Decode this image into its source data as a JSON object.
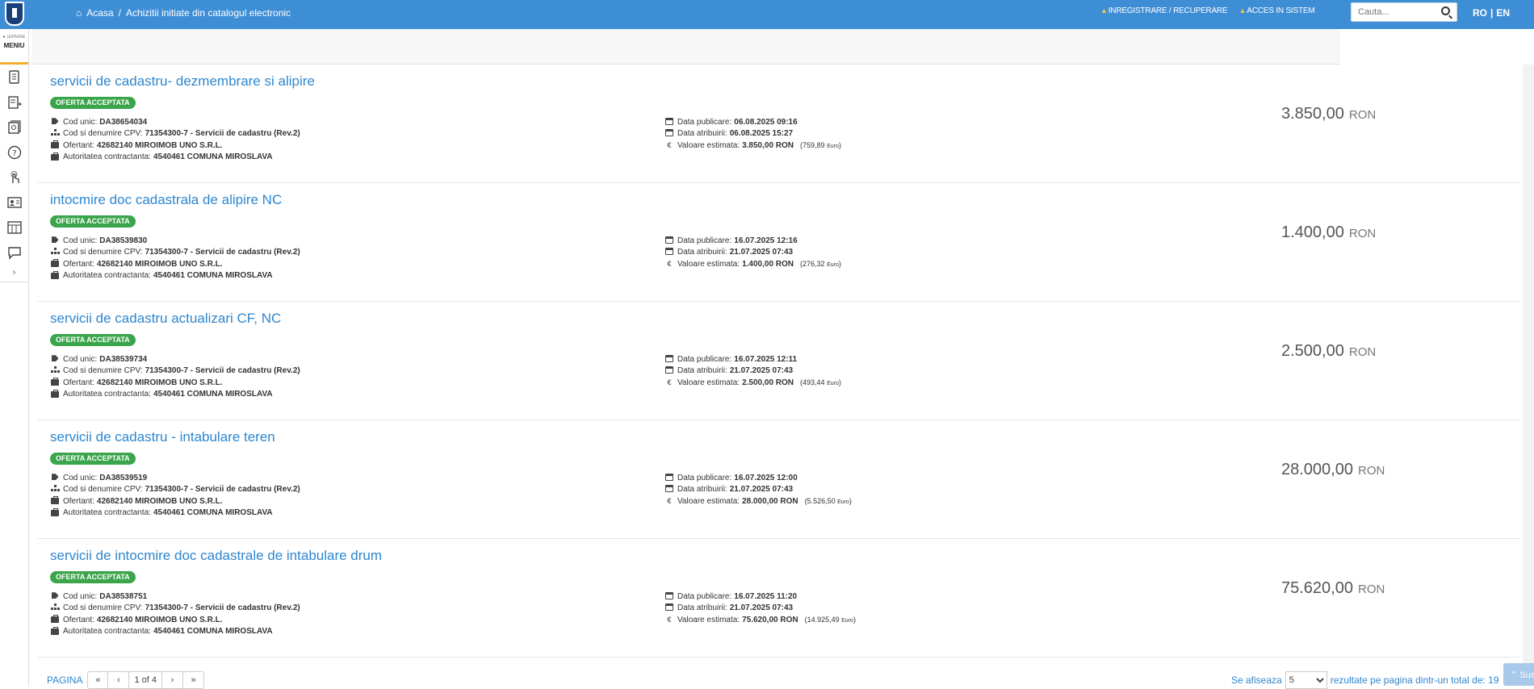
{
  "header": {
    "breadcrumb_home": "Acasa",
    "breadcrumb_sep": "/",
    "breadcrumb_current": "Achizitii initiate din catalogul electronic",
    "nav_register": "INREGISTRARE / RECUPERARE",
    "nav_login": "ACCES IN SISTEM",
    "search_placeholder": "Cauta...",
    "lang_ro": "RO",
    "lang_sep": "|",
    "lang_en": "EN"
  },
  "menu": {
    "small_label": "▸ ucHome",
    "label": "MENIU",
    "expand": "›",
    "icons": [
      "document-icon",
      "list-arrow-icon",
      "book-icon",
      "help-icon",
      "touch-icon",
      "contact-card-icon",
      "catalog-icon",
      "chat-icon"
    ]
  },
  "labels": {
    "cod_unic": "Cod unic:",
    "cpv": "Cod si denumire CPV:",
    "ofertant": "Ofertant:",
    "autoritate": "Autoritatea contractanta:",
    "data_publicare": "Data publicare:",
    "data_atribuire": "Data atribuirii:",
    "valoare": "Valoare estimata:",
    "euro_unit": "Euro",
    "currency": "RON"
  },
  "items": [
    {
      "title": "servicii de cadastru- dezmembrare si alipire",
      "status": "OFERTA ACCEPTATA",
      "cod": "DA38654034",
      "cpv": "71354300-7 - Servicii de cadastru (Rev.2)",
      "ofertant": "42682140 MIROIMOB UNO S.R.L.",
      "autoritate": "4540461 COMUNA MIROSLAVA",
      "data_publicare": "06.08.2025 09:16",
      "data_atribuire": "06.08.2025 15:27",
      "valoare": "3.850,00  RON",
      "euro": "(759,89",
      "price": "3.850,00"
    },
    {
      "title": "intocmire doc cadastrala de alipire NC",
      "status": "OFERTA ACCEPTATA",
      "cod": "DA38539830",
      "cpv": "71354300-7 - Servicii de cadastru (Rev.2)",
      "ofertant": "42682140 MIROIMOB UNO S.R.L.",
      "autoritate": "4540461 COMUNA MIROSLAVA",
      "data_publicare": "16.07.2025 12:16",
      "data_atribuire": "21.07.2025 07:43",
      "valoare": "1.400,00  RON",
      "euro": "(276,32",
      "price": "1.400,00"
    },
    {
      "title": "servicii de cadastru actualizari CF, NC",
      "status": "OFERTA ACCEPTATA",
      "cod": "DA38539734",
      "cpv": "71354300-7 - Servicii de cadastru (Rev.2)",
      "ofertant": "42682140 MIROIMOB UNO S.R.L.",
      "autoritate": "4540461 COMUNA MIROSLAVA",
      "data_publicare": "16.07.2025 12:11",
      "data_atribuire": "21.07.2025 07:43",
      "valoare": "2.500,00  RON",
      "euro": "(493,44",
      "price": "2.500,00"
    },
    {
      "title": "servicii de cadastru - intabulare teren",
      "status": "OFERTA ACCEPTATA",
      "cod": "DA38539519",
      "cpv": "71354300-7 - Servicii de cadastru (Rev.2)",
      "ofertant": "42682140 MIROIMOB UNO S.R.L.",
      "autoritate": "4540461 COMUNA MIROSLAVA",
      "data_publicare": "16.07.2025 12:00",
      "data_atribuire": "21.07.2025 07:43",
      "valoare": "28.000,00  RON",
      "euro": "(5.526,50",
      "price": "28.000,00"
    },
    {
      "title": "servicii de intocmire doc cadastrale de intabulare drum",
      "status": "OFERTA ACCEPTATA",
      "cod": "DA38538751",
      "cpv": "71354300-7 - Servicii de cadastru (Rev.2)",
      "ofertant": "42682140 MIROIMOB UNO S.R.L.",
      "autoritate": "4540461 COMUNA MIROSLAVA",
      "data_publicare": "16.07.2025 11:20",
      "data_atribuire": "21.07.2025 07:43",
      "valoare": "75.620,00  RON",
      "euro": "(14.925,49",
      "price": "75.620,00"
    }
  ],
  "pagination": {
    "label": "PAGINA",
    "first": "«",
    "prev": "‹",
    "current": "1 of 4",
    "next": "›",
    "last": "»",
    "show_prefix": "Se afiseaza",
    "page_size": "5",
    "show_suffix": "rezultate pe pagina dintr-un total de: 19",
    "back_to_top": "⌃ Sus"
  },
  "colors": {
    "topbar": "#3e8ed6",
    "title_link": "#2d86cf",
    "badge": "#3aa54a"
  }
}
